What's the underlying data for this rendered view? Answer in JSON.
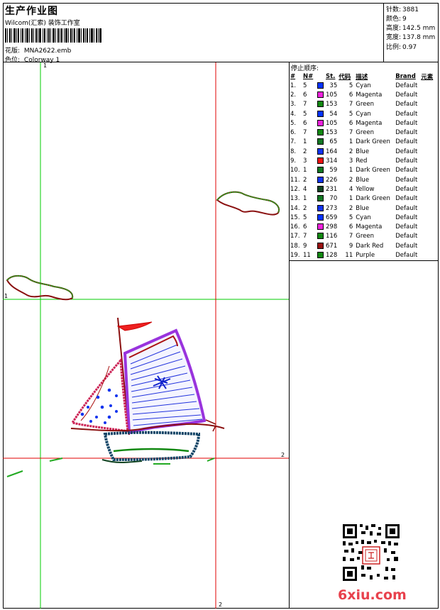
{
  "header": {
    "title": "生产作业图",
    "company": "Wilcom(汇索) 装饰工作室",
    "design_label": "花版:",
    "design_value": "MNA2622.emb",
    "colorway_label": "色位:",
    "colorway_value": "Colorway 1"
  },
  "stats": [
    {
      "label": "针数:",
      "value": "3881"
    },
    {
      "label": "颜色:",
      "value": "9"
    },
    {
      "label": "高度:",
      "value": "142.5 mm"
    },
    {
      "label": "宽度:",
      "value": "137.8 mm"
    },
    {
      "label": "比例:",
      "value": "0.97"
    }
  ],
  "guides": {
    "v1_label": "1",
    "h1_label": "1",
    "v2_label": "2",
    "h2_label": "2",
    "guide_green": "#00cc00",
    "guide_red": "#e00000"
  },
  "stop_panel": {
    "title": "停止顺序:",
    "columns": {
      "idx": "#",
      "needle": "N#",
      "stitches": "St.",
      "code": "代码",
      "desc": "描述",
      "brand": "Brand",
      "elem": "元素"
    },
    "rows": [
      {
        "idx": "1.",
        "needle": "5",
        "color": "#0033ff",
        "stitches": "35",
        "code": "5",
        "desc": "Cyan",
        "brand": "Default"
      },
      {
        "idx": "2.",
        "needle": "6",
        "color": "#ee22dd",
        "stitches": "105",
        "code": "6",
        "desc": "Magenta",
        "brand": "Default"
      },
      {
        "idx": "3.",
        "needle": "7",
        "color": "#118811",
        "stitches": "153",
        "code": "7",
        "desc": "Green",
        "brand": "Default"
      },
      {
        "idx": "4.",
        "needle": "5",
        "color": "#0033ff",
        "stitches": "54",
        "code": "5",
        "desc": "Cyan",
        "brand": "Default"
      },
      {
        "idx": "5.",
        "needle": "6",
        "color": "#ee22dd",
        "stitches": "105",
        "code": "6",
        "desc": "Magenta",
        "brand": "Default"
      },
      {
        "idx": "6.",
        "needle": "7",
        "color": "#118811",
        "stitches": "153",
        "code": "7",
        "desc": "Green",
        "brand": "Default"
      },
      {
        "idx": "7.",
        "needle": "1",
        "color": "#117722",
        "stitches": "65",
        "code": "1",
        "desc": "Dark Green",
        "brand": "Default"
      },
      {
        "idx": "8.",
        "needle": "2",
        "color": "#1133ee",
        "stitches": "164",
        "code": "2",
        "desc": "Blue",
        "brand": "Default"
      },
      {
        "idx": "9.",
        "needle": "3",
        "color": "#ee1111",
        "stitches": "314",
        "code": "3",
        "desc": "Red",
        "brand": "Default"
      },
      {
        "idx": "10.",
        "needle": "1",
        "color": "#117722",
        "stitches": "59",
        "code": "1",
        "desc": "Dark Green",
        "brand": "Default"
      },
      {
        "idx": "11.",
        "needle": "2",
        "color": "#1133ee",
        "stitches": "226",
        "code": "2",
        "desc": "Blue",
        "brand": "Default"
      },
      {
        "idx": "12.",
        "needle": "4",
        "color": "#114422",
        "stitches": "231",
        "code": "4",
        "desc": "Yellow",
        "brand": "Default"
      },
      {
        "idx": "13.",
        "needle": "1",
        "color": "#117722",
        "stitches": "70",
        "code": "1",
        "desc": "Dark Green",
        "brand": "Default"
      },
      {
        "idx": "14.",
        "needle": "2",
        "color": "#1133ee",
        "stitches": "273",
        "code": "2",
        "desc": "Blue",
        "brand": "Default"
      },
      {
        "idx": "15.",
        "needle": "5",
        "color": "#0033ff",
        "stitches": "659",
        "code": "5",
        "desc": "Cyan",
        "brand": "Default"
      },
      {
        "idx": "16.",
        "needle": "6",
        "color": "#ee22dd",
        "stitches": "298",
        "code": "6",
        "desc": "Magenta",
        "brand": "Default"
      },
      {
        "idx": "17.",
        "needle": "7",
        "color": "#118811",
        "stitches": "116",
        "code": "7",
        "desc": "Green",
        "brand": "Default"
      },
      {
        "idx": "18.",
        "needle": "9",
        "color": "#991111",
        "stitches": "671",
        "code": "9",
        "desc": "Dark Red",
        "brand": "Default"
      },
      {
        "idx": "19.",
        "needle": "11",
        "color": "#118811",
        "stitches": "128",
        "code": "11",
        "desc": "Purple",
        "brand": "Default"
      }
    ]
  },
  "watermark": {
    "text": "6xiu.com",
    "color": "#e8414c"
  }
}
